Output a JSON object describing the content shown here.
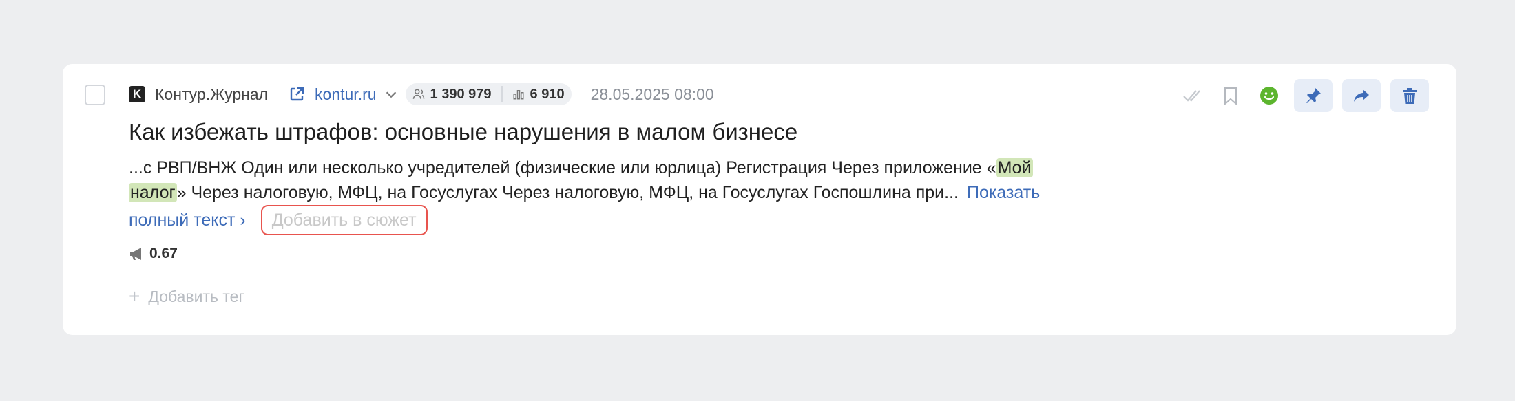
{
  "article": {
    "source_name": "Контур.Журнал",
    "source_logo_letter": "K",
    "domain": "kontur.ru",
    "audience": "1 390 979",
    "views": "6 910",
    "date": "28.05.2025 08:00",
    "title": "Как избежать штрафов: основные нарушения в малом бизнесе",
    "snippet": {
      "part1": "...с РВП/ВНЖ Один или несколько учредителей (физические или юрлица) Регистрация Через приложение «",
      "hl1": "Мой",
      "hl2": "налог",
      "part2": "» Через налоговую, МФЦ, на Госуслугах Через налоговую, МФЦ, на Госуслугах Госпошлина при..."
    },
    "show_full_label": "Показать полный текст ›",
    "add_to_plot_label": "Добавить в сюжет",
    "score": "0.67",
    "add_tag_label": "Добавить тег"
  },
  "colors": {
    "accent": "#3d6bb8",
    "highlight": "#d2e6b8",
    "sentiment_positive": "#5cb52e",
    "focus_outline": "#e8544e"
  }
}
